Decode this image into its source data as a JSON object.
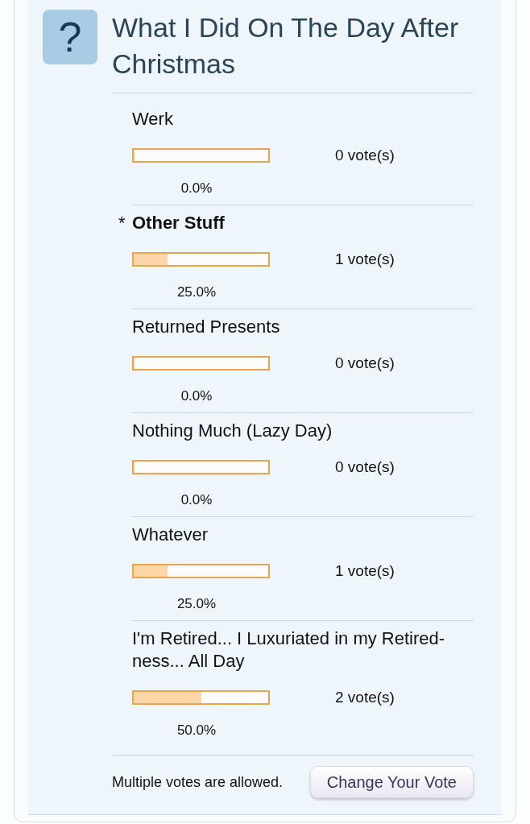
{
  "poll": {
    "icon": "?",
    "title": "What I Did On The Day After Christmas",
    "selection_mark": "*",
    "options": [
      {
        "label": "Werk",
        "selected": false,
        "level": 0,
        "votes": "0 vote(s)",
        "percent": "0.0%"
      },
      {
        "label": "Other Stuff",
        "selected": true,
        "level": 0.25,
        "votes": "1 vote(s)",
        "percent": "25.0%"
      },
      {
        "label": "Returned Presents",
        "selected": false,
        "level": 0,
        "votes": "0 vote(s)",
        "percent": "0.0%"
      },
      {
        "label": "Nothing Much (Lazy Day)",
        "selected": false,
        "level": 0,
        "votes": "0 vote(s)",
        "percent": "0.0%"
      },
      {
        "label": "Whatever",
        "selected": false,
        "level": 0.25,
        "votes": "1 vote(s)",
        "percent": "25.0%"
      },
      {
        "label": "I'm Retired... I Luxuriated in my Retired-ness... All Day",
        "selected": false,
        "level": 0.5,
        "votes": "2 vote(s)",
        "percent": "50.0%"
      }
    ],
    "note": "Multiple votes are allowed.",
    "button": "Change Your Vote"
  }
}
